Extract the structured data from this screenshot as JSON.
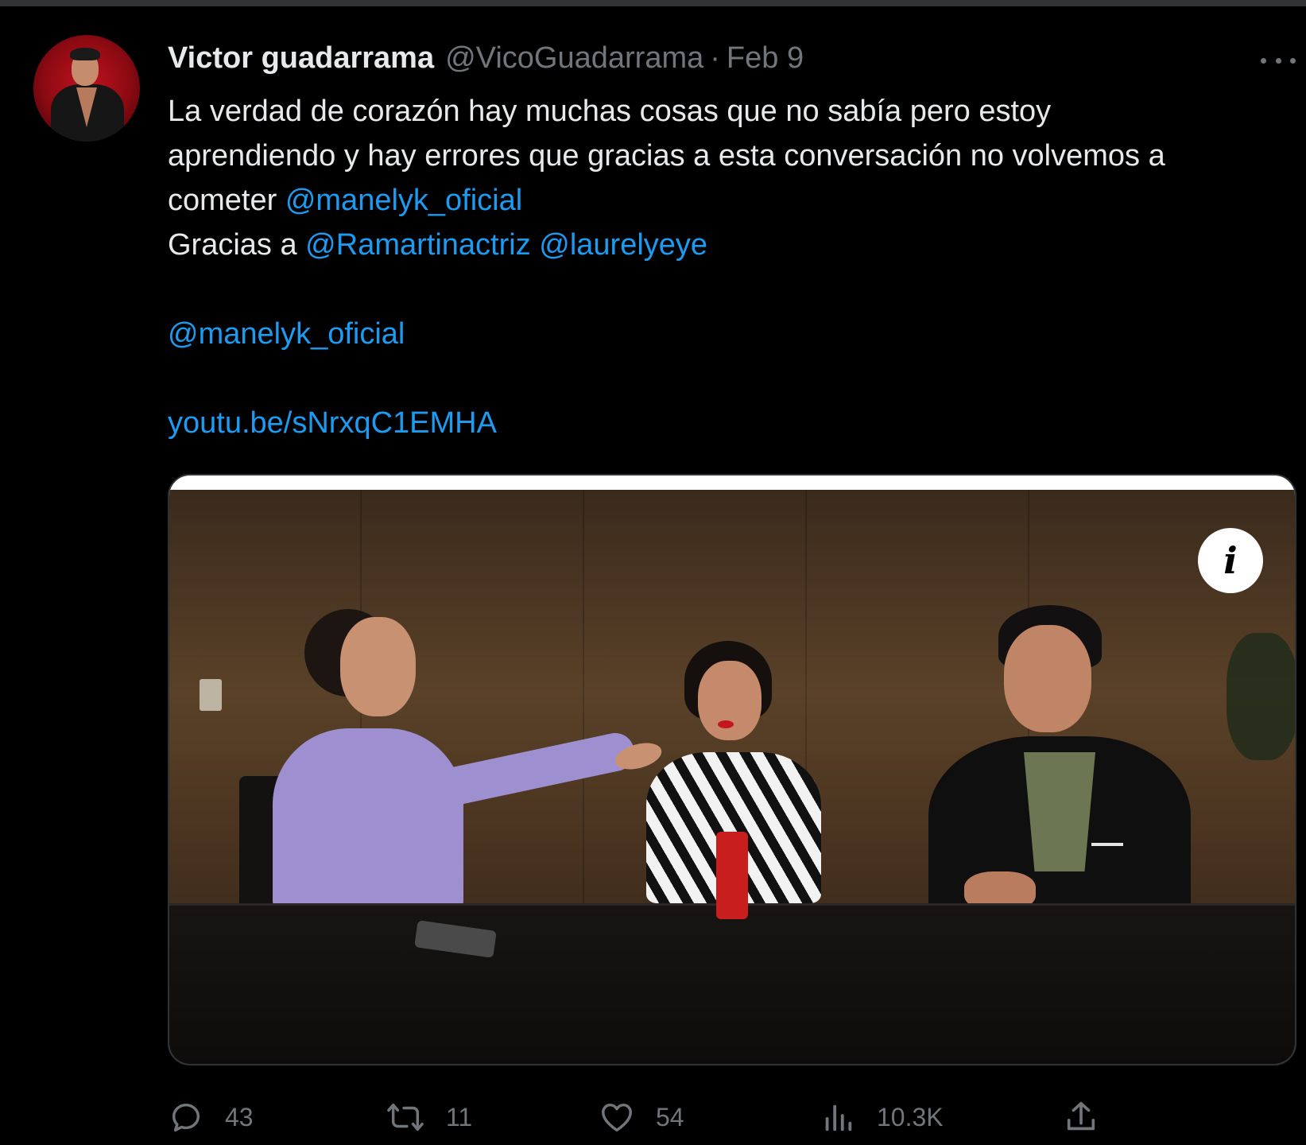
{
  "tweet": {
    "author": {
      "display_name": "Victor guadarrama",
      "handle": "@VicoGuadarrama",
      "separator": "·",
      "date": "Feb 9"
    },
    "text": {
      "line1": "La verdad de corazón hay muchas cosas que no sabía pero estoy",
      "line2": "aprendiendo y hay errores que gracias a esta conversación no volvemos a",
      "line3_prefix": "cometer ",
      "line3_mention": "@manelyk_oficial",
      "line4_prefix": "Gracias a ",
      "line4_mention1": "@Ramartinactriz",
      "line4_mention2": "@laurelyeye",
      "line5_mention": "@manelyk_oficial",
      "line6_link": "youtu.be/sNrxqC1EMHA"
    },
    "media": {
      "info_badge": "i",
      "icon": "info-icon"
    },
    "actions": {
      "reply": {
        "icon": "reply-icon",
        "count": "43"
      },
      "retweet": {
        "icon": "retweet-icon",
        "count": "11"
      },
      "like": {
        "icon": "heart-icon",
        "count": "54"
      },
      "views": {
        "icon": "views-icon",
        "count": "10.3K"
      },
      "share": {
        "icon": "share-icon"
      }
    },
    "more_icon": "more-icon"
  },
  "colors": {
    "background": "#000000",
    "text": "#e7e9ea",
    "secondary": "#71767b",
    "link": "#1d9bf0"
  }
}
